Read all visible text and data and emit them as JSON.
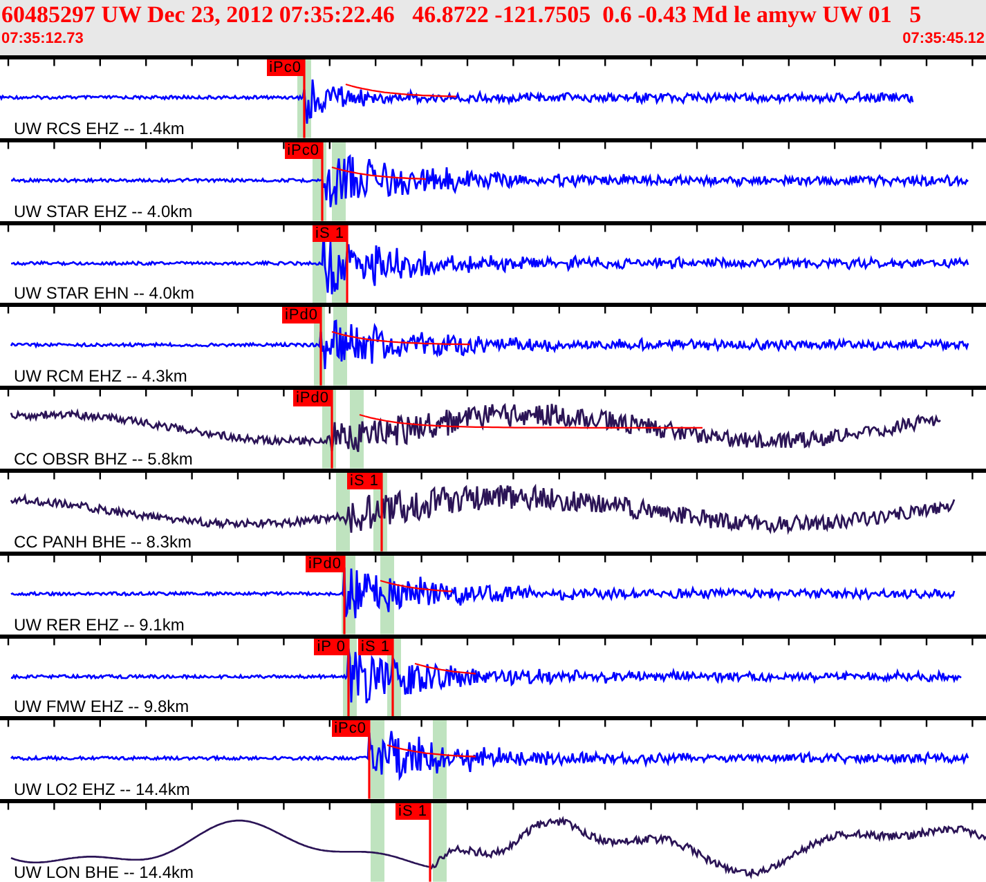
{
  "header": {
    "title": "60485297 UW Dec 23, 2012 07:35:22.46   46.8722 -121.7505  0.6 -0.43 Md le amyw UW 01   5",
    "start_time": "07:35:12.73",
    "end_time": "07:35:45.12"
  },
  "traces": [
    {
      "label": "UW RCS EHZ -- 1.4km",
      "color": "#0000ff",
      "picks": [
        {
          "label": "iPc0"
        }
      ]
    },
    {
      "label": "UW STAR EHZ -- 4.0km",
      "color": "#0000ff",
      "picks": [
        {
          "label": "iPc0"
        }
      ]
    },
    {
      "label": "UW STAR EHN -- 4.0km",
      "color": "#0000ff",
      "picks": [
        {
          "label": "iS 1"
        }
      ]
    },
    {
      "label": "UW RCM EHZ -- 4.3km",
      "color": "#0000ff",
      "picks": [
        {
          "label": "iPd0"
        }
      ]
    },
    {
      "label": "CC OBSR BHZ -- 5.8km",
      "color": "#2b1456",
      "picks": [
        {
          "label": "iPd0"
        }
      ]
    },
    {
      "label": "CC PANH BHE -- 8.3km",
      "color": "#2b1456",
      "picks": [
        {
          "label": "iS 1"
        }
      ]
    },
    {
      "label": "UW RER EHZ -- 9.1km",
      "color": "#0000ff",
      "picks": [
        {
          "label": "iPd0"
        }
      ]
    },
    {
      "label": "UW FMW EHZ -- 9.8km",
      "color": "#0000ff",
      "picks": [
        {
          "label": "iP 0"
        },
        {
          "label": "iS 1"
        }
      ]
    },
    {
      "label": "UW LO2 EHZ -- 14.4km",
      "color": "#0000ff",
      "picks": [
        {
          "label": "iPc0"
        }
      ]
    },
    {
      "label": "UW LON BHE -- 14.4km",
      "color": "#2b1456",
      "picks": [
        {
          "label": "iS 1"
        }
      ]
    }
  ]
}
